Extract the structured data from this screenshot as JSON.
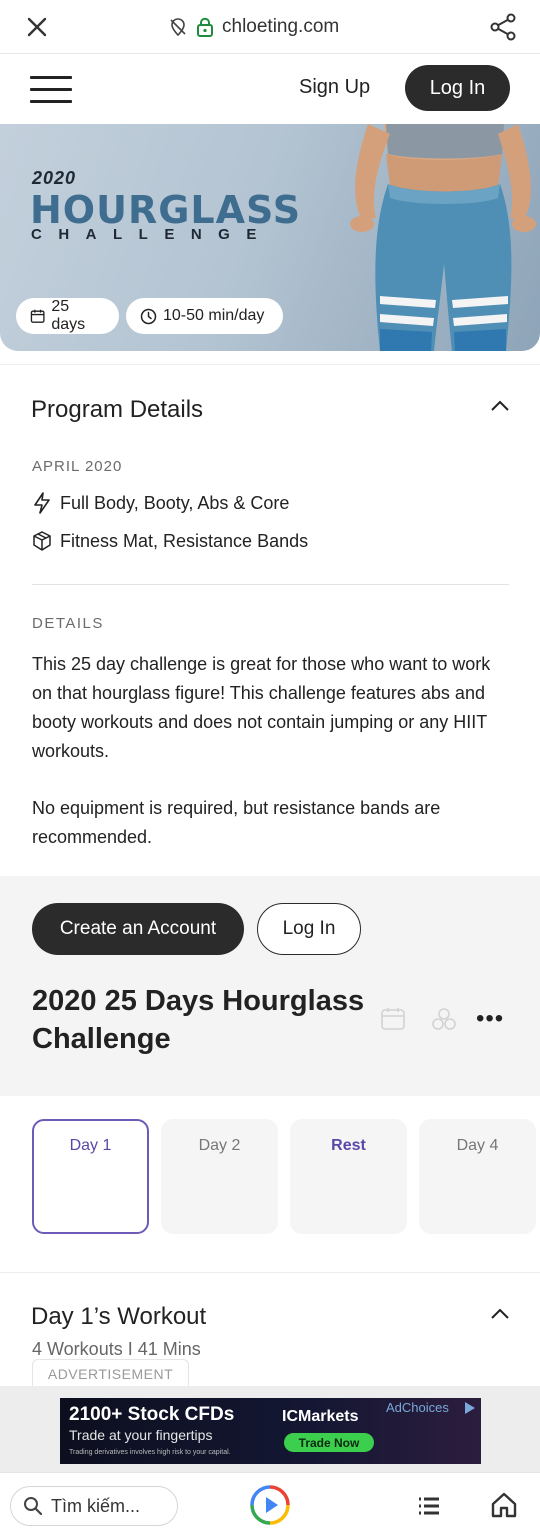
{
  "browser": {
    "url": "chloeting.com",
    "icons": [
      "close-icon",
      "location-off-icon",
      "lock-icon",
      "share-icon"
    ]
  },
  "header": {
    "signup_label": "Sign Up",
    "login_label": "Log In"
  },
  "hero": {
    "year": "2020",
    "title": "HOURGLASS",
    "subtitle": "CHALLENGE",
    "days_chip": "25 days",
    "time_chip": "10-50 min/day"
  },
  "program_details": {
    "title": "Program Details",
    "date": "APRIL 2020",
    "focus": "Full Body, Booty, Abs & Core",
    "equipment": "Fitness Mat, Resistance Bands",
    "details_label": "DETAILS",
    "description": "This 25 day challenge is great for those who want to work on that hourglass figure! This challenge features abs and booty workouts and does not contain jumping or any HIIT workouts.",
    "description2": "No equipment is required, but resistance bands are recommended."
  },
  "account": {
    "create_label": "Create an Account",
    "login_label": "Log In",
    "challenge_title": "2020 25 Days Hourglass Challenge",
    "more_label": "•••"
  },
  "days": [
    {
      "label": "Day 1"
    },
    {
      "label": "Day 2"
    },
    {
      "label": "Rest"
    },
    {
      "label": "Day 4"
    }
  ],
  "workout": {
    "title": "Day 1’s Workout",
    "subtitle": "4 Workouts I 41 Mins",
    "ad_label": "ADVERTISEMENT"
  },
  "ad": {
    "headline": "2100+ Stock  CFDs",
    "subline": "Trade at your fingertips",
    "fineprint": "Trading derivatives involves high risk to your capital.",
    "brand": "ICMarkets",
    "cta": "Trade Now",
    "choices": "AdChoices"
  },
  "bottom_nav": {
    "search_placeholder": "Tìm kiếm..."
  },
  "colors": {
    "accent_purple": "#5a47a8",
    "dark_button": "#2b2b2b",
    "hero_title_blue": "#3e6d8f"
  }
}
